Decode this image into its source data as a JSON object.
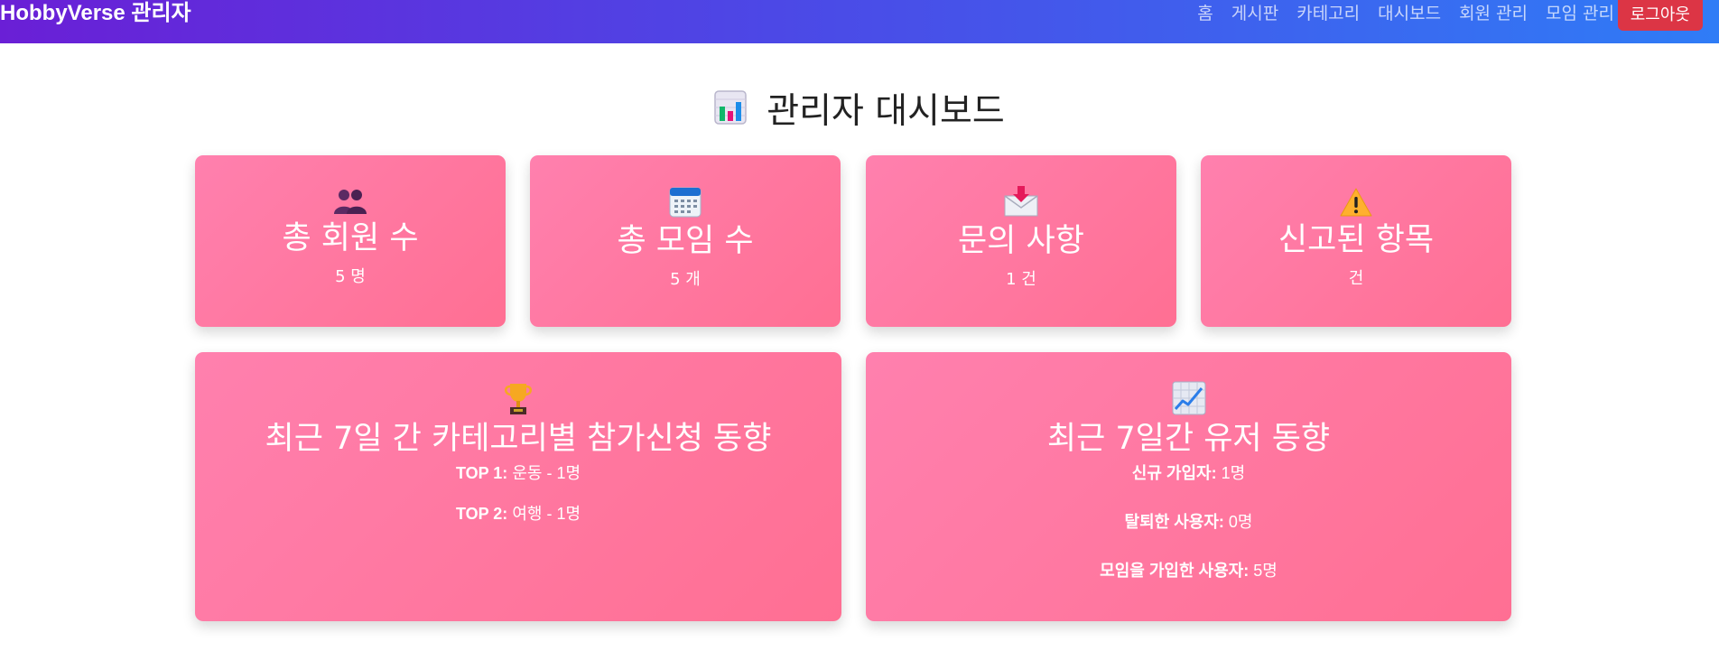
{
  "navbar": {
    "brand": "HobbyVerse 관리자",
    "links": [
      "홈",
      "게시판",
      "카테고리",
      "대시보드",
      "회원 관리",
      "모임 관리"
    ],
    "logout_label": "로그아웃"
  },
  "page": {
    "title": "관리자 대시보드",
    "title_icon": "bar-chart-icon"
  },
  "stats": [
    {
      "icon": "people-icon",
      "title": "총 회원 수",
      "value": "5 명"
    },
    {
      "icon": "calendar-icon",
      "title": "총 모임 수",
      "value": "5 개"
    },
    {
      "icon": "inbox-icon",
      "title": "문의 사항",
      "value": "1 건"
    },
    {
      "icon": "warning-icon",
      "title": "신고된 항목",
      "value": "건"
    }
  ],
  "category_trend": {
    "icon": "trophy-icon",
    "title": "최근 7일 간 카테고리별 참가신청 동향",
    "items": [
      {
        "rank": "TOP 1:",
        "category": "운동",
        "sep": "-",
        "count": "1명"
      },
      {
        "rank": "TOP 2:",
        "category": "여행",
        "sep": "-",
        "count": "1명"
      }
    ]
  },
  "user_trend": {
    "icon": "trend-chart-icon",
    "title": "최근 7일간 유저 동향",
    "items": [
      {
        "label": "신규 가입자:",
        "value": "1명"
      },
      {
        "label": "탈퇴한 사용자:",
        "value": "0명"
      },
      {
        "label": "모임을 가입한 사용자:",
        "value": "5명"
      }
    ]
  },
  "colors": {
    "nav_start": "#6a1fd6",
    "nav_end": "#2f7cf6",
    "card": "#ff7aa2",
    "logout": "#dc3545"
  }
}
